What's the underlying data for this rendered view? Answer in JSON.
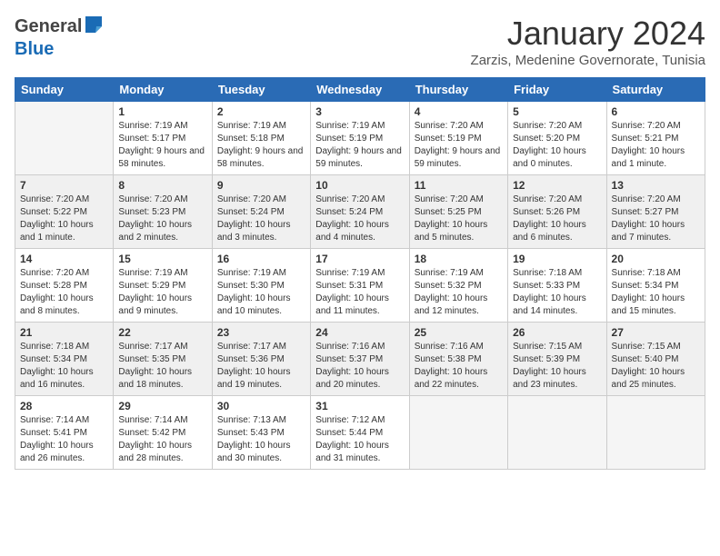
{
  "logo": {
    "general": "General",
    "blue": "Blue"
  },
  "title": "January 2024",
  "subtitle": "Zarzis, Medenine Governorate, Tunisia",
  "days_of_week": [
    "Sunday",
    "Monday",
    "Tuesday",
    "Wednesday",
    "Thursday",
    "Friday",
    "Saturday"
  ],
  "weeks": [
    [
      {
        "day": "",
        "sunrise": "",
        "sunset": "",
        "daylight": "",
        "empty": true
      },
      {
        "day": "1",
        "sunrise": "Sunrise: 7:19 AM",
        "sunset": "Sunset: 5:17 PM",
        "daylight": "Daylight: 9 hours and 58 minutes.",
        "empty": false
      },
      {
        "day": "2",
        "sunrise": "Sunrise: 7:19 AM",
        "sunset": "Sunset: 5:18 PM",
        "daylight": "Daylight: 9 hours and 58 minutes.",
        "empty": false
      },
      {
        "day": "3",
        "sunrise": "Sunrise: 7:19 AM",
        "sunset": "Sunset: 5:19 PM",
        "daylight": "Daylight: 9 hours and 59 minutes.",
        "empty": false
      },
      {
        "day": "4",
        "sunrise": "Sunrise: 7:20 AM",
        "sunset": "Sunset: 5:19 PM",
        "daylight": "Daylight: 9 hours and 59 minutes.",
        "empty": false
      },
      {
        "day": "5",
        "sunrise": "Sunrise: 7:20 AM",
        "sunset": "Sunset: 5:20 PM",
        "daylight": "Daylight: 10 hours and 0 minutes.",
        "empty": false
      },
      {
        "day": "6",
        "sunrise": "Sunrise: 7:20 AM",
        "sunset": "Sunset: 5:21 PM",
        "daylight": "Daylight: 10 hours and 1 minute.",
        "empty": false
      }
    ],
    [
      {
        "day": "7",
        "sunrise": "Sunrise: 7:20 AM",
        "sunset": "Sunset: 5:22 PM",
        "daylight": "Daylight: 10 hours and 1 minute.",
        "empty": false
      },
      {
        "day": "8",
        "sunrise": "Sunrise: 7:20 AM",
        "sunset": "Sunset: 5:23 PM",
        "daylight": "Daylight: 10 hours and 2 minutes.",
        "empty": false
      },
      {
        "day": "9",
        "sunrise": "Sunrise: 7:20 AM",
        "sunset": "Sunset: 5:24 PM",
        "daylight": "Daylight: 10 hours and 3 minutes.",
        "empty": false
      },
      {
        "day": "10",
        "sunrise": "Sunrise: 7:20 AM",
        "sunset": "Sunset: 5:24 PM",
        "daylight": "Daylight: 10 hours and 4 minutes.",
        "empty": false
      },
      {
        "day": "11",
        "sunrise": "Sunrise: 7:20 AM",
        "sunset": "Sunset: 5:25 PM",
        "daylight": "Daylight: 10 hours and 5 minutes.",
        "empty": false
      },
      {
        "day": "12",
        "sunrise": "Sunrise: 7:20 AM",
        "sunset": "Sunset: 5:26 PM",
        "daylight": "Daylight: 10 hours and 6 minutes.",
        "empty": false
      },
      {
        "day": "13",
        "sunrise": "Sunrise: 7:20 AM",
        "sunset": "Sunset: 5:27 PM",
        "daylight": "Daylight: 10 hours and 7 minutes.",
        "empty": false
      }
    ],
    [
      {
        "day": "14",
        "sunrise": "Sunrise: 7:20 AM",
        "sunset": "Sunset: 5:28 PM",
        "daylight": "Daylight: 10 hours and 8 minutes.",
        "empty": false
      },
      {
        "day": "15",
        "sunrise": "Sunrise: 7:19 AM",
        "sunset": "Sunset: 5:29 PM",
        "daylight": "Daylight: 10 hours and 9 minutes.",
        "empty": false
      },
      {
        "day": "16",
        "sunrise": "Sunrise: 7:19 AM",
        "sunset": "Sunset: 5:30 PM",
        "daylight": "Daylight: 10 hours and 10 minutes.",
        "empty": false
      },
      {
        "day": "17",
        "sunrise": "Sunrise: 7:19 AM",
        "sunset": "Sunset: 5:31 PM",
        "daylight": "Daylight: 10 hours and 11 minutes.",
        "empty": false
      },
      {
        "day": "18",
        "sunrise": "Sunrise: 7:19 AM",
        "sunset": "Sunset: 5:32 PM",
        "daylight": "Daylight: 10 hours and 12 minutes.",
        "empty": false
      },
      {
        "day": "19",
        "sunrise": "Sunrise: 7:18 AM",
        "sunset": "Sunset: 5:33 PM",
        "daylight": "Daylight: 10 hours and 14 minutes.",
        "empty": false
      },
      {
        "day": "20",
        "sunrise": "Sunrise: 7:18 AM",
        "sunset": "Sunset: 5:34 PM",
        "daylight": "Daylight: 10 hours and 15 minutes.",
        "empty": false
      }
    ],
    [
      {
        "day": "21",
        "sunrise": "Sunrise: 7:18 AM",
        "sunset": "Sunset: 5:34 PM",
        "daylight": "Daylight: 10 hours and 16 minutes.",
        "empty": false
      },
      {
        "day": "22",
        "sunrise": "Sunrise: 7:17 AM",
        "sunset": "Sunset: 5:35 PM",
        "daylight": "Daylight: 10 hours and 18 minutes.",
        "empty": false
      },
      {
        "day": "23",
        "sunrise": "Sunrise: 7:17 AM",
        "sunset": "Sunset: 5:36 PM",
        "daylight": "Daylight: 10 hours and 19 minutes.",
        "empty": false
      },
      {
        "day": "24",
        "sunrise": "Sunrise: 7:16 AM",
        "sunset": "Sunset: 5:37 PM",
        "daylight": "Daylight: 10 hours and 20 minutes.",
        "empty": false
      },
      {
        "day": "25",
        "sunrise": "Sunrise: 7:16 AM",
        "sunset": "Sunset: 5:38 PM",
        "daylight": "Daylight: 10 hours and 22 minutes.",
        "empty": false
      },
      {
        "day": "26",
        "sunrise": "Sunrise: 7:15 AM",
        "sunset": "Sunset: 5:39 PM",
        "daylight": "Daylight: 10 hours and 23 minutes.",
        "empty": false
      },
      {
        "day": "27",
        "sunrise": "Sunrise: 7:15 AM",
        "sunset": "Sunset: 5:40 PM",
        "daylight": "Daylight: 10 hours and 25 minutes.",
        "empty": false
      }
    ],
    [
      {
        "day": "28",
        "sunrise": "Sunrise: 7:14 AM",
        "sunset": "Sunset: 5:41 PM",
        "daylight": "Daylight: 10 hours and 26 minutes.",
        "empty": false
      },
      {
        "day": "29",
        "sunrise": "Sunrise: 7:14 AM",
        "sunset": "Sunset: 5:42 PM",
        "daylight": "Daylight: 10 hours and 28 minutes.",
        "empty": false
      },
      {
        "day": "30",
        "sunrise": "Sunrise: 7:13 AM",
        "sunset": "Sunset: 5:43 PM",
        "daylight": "Daylight: 10 hours and 30 minutes.",
        "empty": false
      },
      {
        "day": "31",
        "sunrise": "Sunrise: 7:12 AM",
        "sunset": "Sunset: 5:44 PM",
        "daylight": "Daylight: 10 hours and 31 minutes.",
        "empty": false
      },
      {
        "day": "",
        "sunrise": "",
        "sunset": "",
        "daylight": "",
        "empty": true
      },
      {
        "day": "",
        "sunrise": "",
        "sunset": "",
        "daylight": "",
        "empty": true
      },
      {
        "day": "",
        "sunrise": "",
        "sunset": "",
        "daylight": "",
        "empty": true
      }
    ]
  ]
}
